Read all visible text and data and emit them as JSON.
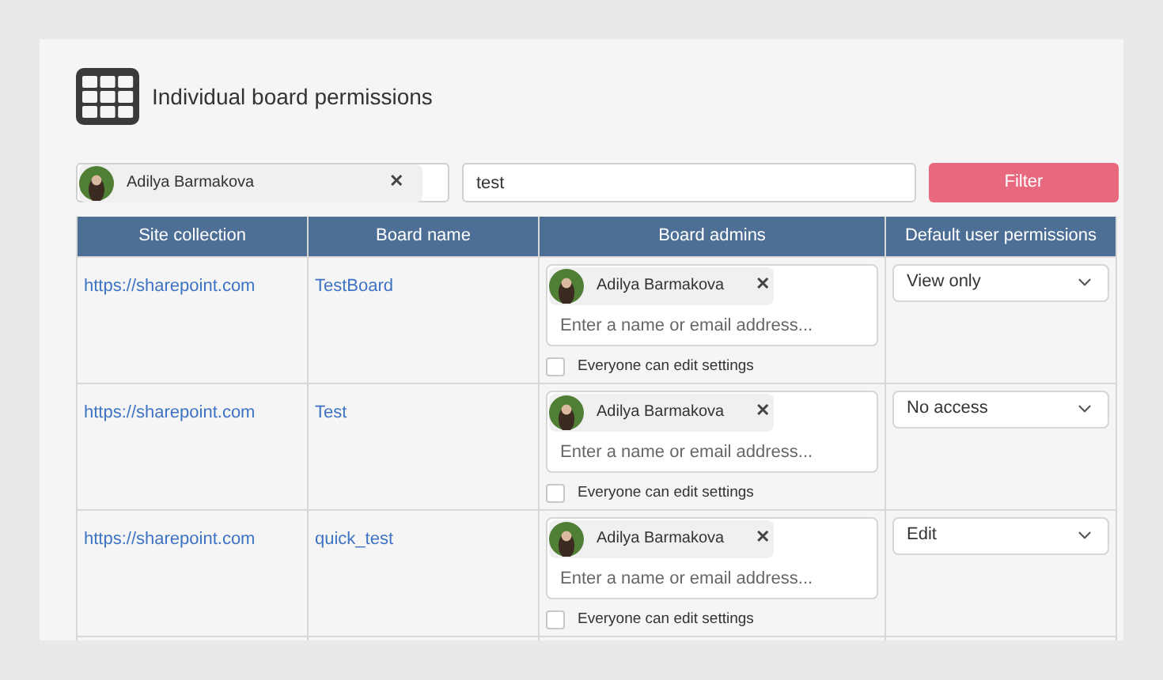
{
  "title": "Individual board permissions",
  "filter": {
    "person": {
      "name": "Adilya Barmakova",
      "remove": "✕"
    },
    "search_value": "test",
    "button": "Filter"
  },
  "table": {
    "columns": [
      "Site collection",
      "Board name",
      "Board admins",
      "Default user permissions"
    ],
    "rows": [
      {
        "site": "https://sharepoint.com",
        "board": "TestBoard",
        "admins": [
          {
            "name": "Adilya Barmakova",
            "remove": "✕"
          }
        ],
        "admin_placeholder": "Enter a name or email address...",
        "everyone_edit": {
          "label": "Everyone can edit settings",
          "checked": false
        },
        "permission": "View only"
      },
      {
        "site": "https://sharepoint.com",
        "board": "Test",
        "admins": [
          {
            "name": "Adilya Barmakova",
            "remove": "✕"
          }
        ],
        "admin_placeholder": "Enter a name or email address...",
        "everyone_edit": {
          "label": "Everyone can edit settings",
          "checked": false
        },
        "permission": "No access"
      },
      {
        "site": "https://sharepoint.com",
        "board": "quick_test",
        "admins": [
          {
            "name": "Adilya Barmakova",
            "remove": "✕"
          }
        ],
        "admin_placeholder": "Enter a name or email address...",
        "everyone_edit": {
          "label": "Everyone can edit settings",
          "checked": false
        },
        "permission": "Edit"
      }
    ]
  }
}
